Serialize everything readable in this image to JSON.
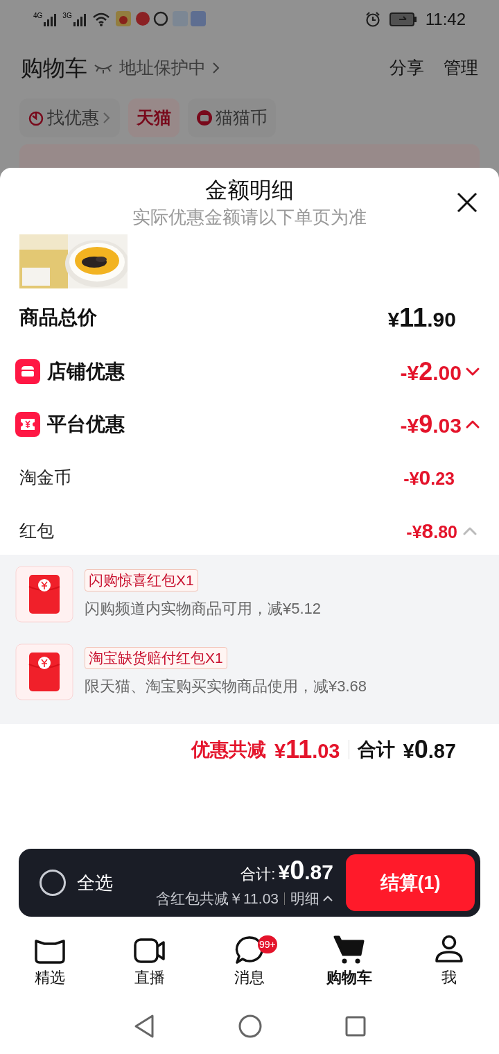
{
  "status_bar": {
    "networks": [
      "4G",
      "3G"
    ],
    "time": "11:42"
  },
  "header": {
    "title": "购物车",
    "address": "地址保护中",
    "actions": [
      "分享",
      "管理"
    ]
  },
  "chips": [
    {
      "label": "找优惠",
      "kind": "deals"
    },
    {
      "label": "天猫",
      "kind": "brand"
    },
    {
      "label": "猫猫币",
      "kind": "coin"
    }
  ],
  "sheet": {
    "title": "金额明细",
    "subtitle": "实际优惠金额请以下单页为准",
    "total": {
      "label": "商品总价",
      "amount": {
        "prefix": "¥",
        "major": "11",
        "minor": ".90"
      }
    },
    "discounts": [
      {
        "kind": "shop",
        "label": "店铺优惠",
        "amount": {
          "prefix": "-¥",
          "major": "2",
          "minor": ".00"
        },
        "expanded": false
      },
      {
        "kind": "platform",
        "label": "平台优惠",
        "amount": {
          "prefix": "-¥",
          "major": "9",
          "minor": ".03"
        },
        "expanded": true,
        "items": [
          {
            "kind": "plain",
            "label": "淘金币",
            "amount": {
              "prefix": "-¥",
              "major": "0",
              "minor": ".23"
            }
          },
          {
            "kind": "expandable",
            "label": "红包",
            "amount": {
              "prefix": "-¥",
              "major": "8",
              "minor": ".80"
            },
            "expanded": true,
            "coupons": [
              {
                "tag": "闪购惊喜红包X1",
                "description": "闪购频道内实物商品可用，减¥5.12"
              },
              {
                "tag": "淘宝缺货赔付红包X1",
                "description": "限天猫、淘宝购买实物商品使用，减¥3.68"
              }
            ]
          }
        ]
      }
    ],
    "summary": {
      "saving_label": "优惠共减",
      "saving": {
        "prefix": "¥",
        "major": "11",
        "minor": ".03"
      },
      "total_label": "合计",
      "total": {
        "prefix": "¥",
        "major": "0",
        "minor": ".87"
      }
    }
  },
  "checkout": {
    "select_all": {
      "label": "全选",
      "checked": false
    },
    "total_label": "合计:",
    "total": {
      "prefix": "¥",
      "major": "0",
      "minor": ".87"
    },
    "note": "含红包共减￥11.03",
    "detail": "明细",
    "button": "结算(1)"
  },
  "tabs": [
    {
      "label": "精选",
      "kind": "home",
      "selected": false
    },
    {
      "label": "直播",
      "kind": "live",
      "selected": false
    },
    {
      "label": "消息",
      "kind": "messages",
      "selected": false,
      "badge": "99+"
    },
    {
      "label": "购物车",
      "kind": "cart",
      "selected": true
    },
    {
      "label": "我",
      "kind": "me",
      "selected": false
    }
  ]
}
